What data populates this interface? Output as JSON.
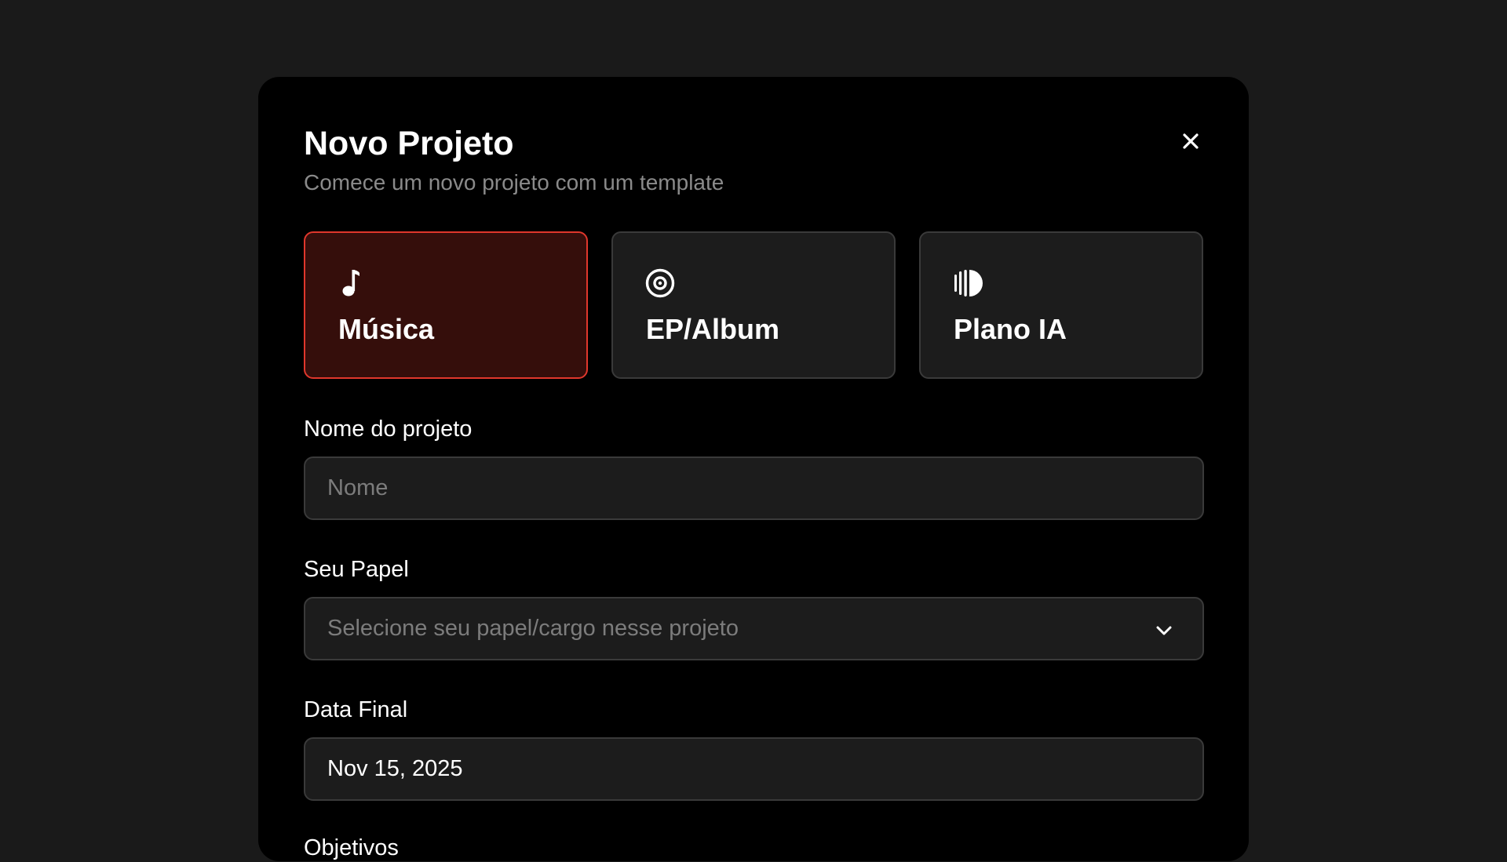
{
  "modal": {
    "title": "Novo Projeto",
    "subtitle": "Comece um novo projeto com um template",
    "close_icon": "close-icon"
  },
  "templates": [
    {
      "label": "Música",
      "icon": "music-note-icon",
      "selected": true
    },
    {
      "label": "EP/Album",
      "icon": "disc-icon",
      "selected": false
    },
    {
      "label": "Plano IA",
      "icon": "ai-plan-icon",
      "selected": false
    }
  ],
  "form": {
    "project_name": {
      "label": "Nome do projeto",
      "placeholder": "Nome",
      "value": ""
    },
    "role": {
      "label": "Seu Papel",
      "placeholder": "Selecione seu papel/cargo nesse projeto"
    },
    "end_date": {
      "label": "Data Final",
      "value": "Nov 15, 2025"
    },
    "objectives": {
      "label": "Objetivos"
    }
  },
  "colors": {
    "page_background": "#1a1a1a",
    "modal_background": "#000000",
    "card_background": "#1c1c1c",
    "selected_card_background": "#350e0b",
    "selected_card_border": "#e0372c",
    "subtitle_text": "#8a8a8a"
  }
}
